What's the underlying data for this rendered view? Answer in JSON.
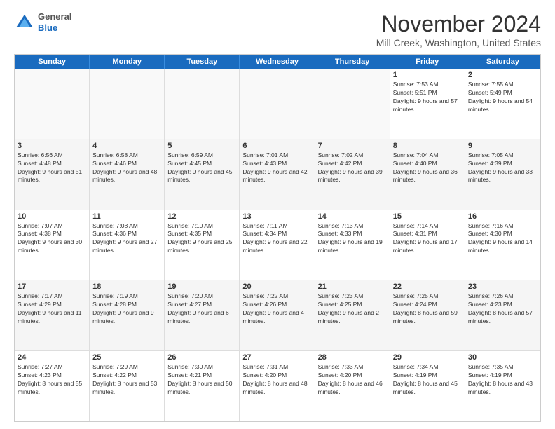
{
  "logo": {
    "line1": "General",
    "line2": "Blue"
  },
  "title": "November 2024",
  "location": "Mill Creek, Washington, United States",
  "header_days": [
    "Sunday",
    "Monday",
    "Tuesday",
    "Wednesday",
    "Thursday",
    "Friday",
    "Saturday"
  ],
  "rows": [
    [
      {
        "day": "",
        "empty": true,
        "detail": ""
      },
      {
        "day": "",
        "empty": true,
        "detail": ""
      },
      {
        "day": "",
        "empty": true,
        "detail": ""
      },
      {
        "day": "",
        "empty": true,
        "detail": ""
      },
      {
        "day": "",
        "empty": true,
        "detail": ""
      },
      {
        "day": "1",
        "detail": "Sunrise: 7:53 AM\nSunset: 5:51 PM\nDaylight: 9 hours and 57 minutes."
      },
      {
        "day": "2",
        "detail": "Sunrise: 7:55 AM\nSunset: 5:49 PM\nDaylight: 9 hours and 54 minutes."
      }
    ],
    [
      {
        "day": "3",
        "detail": "Sunrise: 6:56 AM\nSunset: 4:48 PM\nDaylight: 9 hours and 51 minutes."
      },
      {
        "day": "4",
        "detail": "Sunrise: 6:58 AM\nSunset: 4:46 PM\nDaylight: 9 hours and 48 minutes."
      },
      {
        "day": "5",
        "detail": "Sunrise: 6:59 AM\nSunset: 4:45 PM\nDaylight: 9 hours and 45 minutes."
      },
      {
        "day": "6",
        "detail": "Sunrise: 7:01 AM\nSunset: 4:43 PM\nDaylight: 9 hours and 42 minutes."
      },
      {
        "day": "7",
        "detail": "Sunrise: 7:02 AM\nSunset: 4:42 PM\nDaylight: 9 hours and 39 minutes."
      },
      {
        "day": "8",
        "detail": "Sunrise: 7:04 AM\nSunset: 4:40 PM\nDaylight: 9 hours and 36 minutes."
      },
      {
        "day": "9",
        "detail": "Sunrise: 7:05 AM\nSunset: 4:39 PM\nDaylight: 9 hours and 33 minutes."
      }
    ],
    [
      {
        "day": "10",
        "detail": "Sunrise: 7:07 AM\nSunset: 4:38 PM\nDaylight: 9 hours and 30 minutes."
      },
      {
        "day": "11",
        "detail": "Sunrise: 7:08 AM\nSunset: 4:36 PM\nDaylight: 9 hours and 27 minutes."
      },
      {
        "day": "12",
        "detail": "Sunrise: 7:10 AM\nSunset: 4:35 PM\nDaylight: 9 hours and 25 minutes."
      },
      {
        "day": "13",
        "detail": "Sunrise: 7:11 AM\nSunset: 4:34 PM\nDaylight: 9 hours and 22 minutes."
      },
      {
        "day": "14",
        "detail": "Sunrise: 7:13 AM\nSunset: 4:33 PM\nDaylight: 9 hours and 19 minutes."
      },
      {
        "day": "15",
        "detail": "Sunrise: 7:14 AM\nSunset: 4:31 PM\nDaylight: 9 hours and 17 minutes."
      },
      {
        "day": "16",
        "detail": "Sunrise: 7:16 AM\nSunset: 4:30 PM\nDaylight: 9 hours and 14 minutes."
      }
    ],
    [
      {
        "day": "17",
        "detail": "Sunrise: 7:17 AM\nSunset: 4:29 PM\nDaylight: 9 hours and 11 minutes."
      },
      {
        "day": "18",
        "detail": "Sunrise: 7:19 AM\nSunset: 4:28 PM\nDaylight: 9 hours and 9 minutes."
      },
      {
        "day": "19",
        "detail": "Sunrise: 7:20 AM\nSunset: 4:27 PM\nDaylight: 9 hours and 6 minutes."
      },
      {
        "day": "20",
        "detail": "Sunrise: 7:22 AM\nSunset: 4:26 PM\nDaylight: 9 hours and 4 minutes."
      },
      {
        "day": "21",
        "detail": "Sunrise: 7:23 AM\nSunset: 4:25 PM\nDaylight: 9 hours and 2 minutes."
      },
      {
        "day": "22",
        "detail": "Sunrise: 7:25 AM\nSunset: 4:24 PM\nDaylight: 8 hours and 59 minutes."
      },
      {
        "day": "23",
        "detail": "Sunrise: 7:26 AM\nSunset: 4:23 PM\nDaylight: 8 hours and 57 minutes."
      }
    ],
    [
      {
        "day": "24",
        "detail": "Sunrise: 7:27 AM\nSunset: 4:23 PM\nDaylight: 8 hours and 55 minutes."
      },
      {
        "day": "25",
        "detail": "Sunrise: 7:29 AM\nSunset: 4:22 PM\nDaylight: 8 hours and 53 minutes."
      },
      {
        "day": "26",
        "detail": "Sunrise: 7:30 AM\nSunset: 4:21 PM\nDaylight: 8 hours and 50 minutes."
      },
      {
        "day": "27",
        "detail": "Sunrise: 7:31 AM\nSunset: 4:20 PM\nDaylight: 8 hours and 48 minutes."
      },
      {
        "day": "28",
        "detail": "Sunrise: 7:33 AM\nSunset: 4:20 PM\nDaylight: 8 hours and 46 minutes."
      },
      {
        "day": "29",
        "detail": "Sunrise: 7:34 AM\nSunset: 4:19 PM\nDaylight: 8 hours and 45 minutes."
      },
      {
        "day": "30",
        "detail": "Sunrise: 7:35 AM\nSunset: 4:19 PM\nDaylight: 8 hours and 43 minutes."
      }
    ]
  ]
}
